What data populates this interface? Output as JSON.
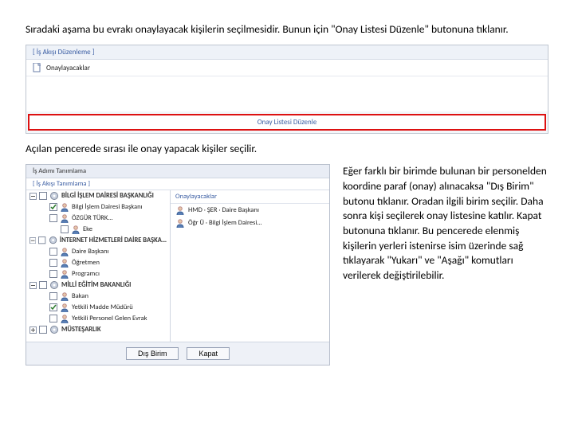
{
  "intro": "Sıradaki aşama bu evrakı onaylayacak kişilerin seçilmesidir. Bunun için \"Onay Listesi Düzenle\" butonuna tıklanır.",
  "win1": {
    "title": "[ İş Akışı Düzenleme ]",
    "node": "Onaylayacaklar",
    "highlight": "Onay Listesi Düzenle"
  },
  "mid": "Açılan pencerede sırası ile onay yapacak kişiler seçilir.",
  "win2": {
    "title": "İş Adımı Tanımlama",
    "subtitle": "[ İş Akışı Tanımlama ]",
    "right_head": "Onaylayacaklar",
    "tree": [
      {
        "lvl": 1,
        "toggle": "-",
        "chk": false,
        "label": "BİLGİ İŞLEM DAİRESİ BAŞKANLIĞI",
        "bold": true
      },
      {
        "lvl": 2,
        "toggle": "",
        "chk": true,
        "label": "Bilgi İşlem Dairesi Başkanı"
      },
      {
        "lvl": 2,
        "toggle": "",
        "chk": false,
        "label": "ÖZGÜR TÜRK…"
      },
      {
        "lvl": 3,
        "toggle": "",
        "chk": false,
        "label": "Eke"
      },
      {
        "lvl": 1,
        "toggle": "-",
        "chk": false,
        "label": "İNTERNET HİZMETLERİ DAİRE BAŞKA…",
        "bold": true
      },
      {
        "lvl": 2,
        "toggle": "",
        "chk": false,
        "label": "Daire Başkanı"
      },
      {
        "lvl": 2,
        "toggle": "",
        "chk": false,
        "label": "Öğretmen"
      },
      {
        "lvl": 2,
        "toggle": "",
        "chk": false,
        "label": "Programcı"
      },
      {
        "lvl": 1,
        "toggle": "-",
        "chk": false,
        "label": "MİLLİ EĞİTİM BAKANLIĞI",
        "bold": true
      },
      {
        "lvl": 2,
        "toggle": "",
        "chk": false,
        "label": "Bakan"
      },
      {
        "lvl": 2,
        "toggle": "",
        "chk": true,
        "label": "Yetkili Madde Müdürü"
      },
      {
        "lvl": 2,
        "toggle": "",
        "chk": false,
        "label": "Yetkili Personel Gelen Evrak"
      },
      {
        "lvl": 1,
        "toggle": "+",
        "chk": false,
        "label": "MÜSTEŞARLIK",
        "bold": true
      }
    ],
    "rlist": [
      {
        "label": "HMD · ŞER · Daire Başkanı"
      },
      {
        "label": "Öğr Ü · Bilgi İşlem Dairesi…"
      }
    ],
    "btn_dis": "Dış Birim",
    "btn_kapat": "Kapat"
  },
  "rtext": "Eğer farklı bir birimde bulunan bir personelden koordine paraf (onay) alınacaksa \"Dış Birim\" butonu tıklanır. Oradan ilgili birim seçilir. Daha sonra kişi seçilerek onay listesine katılır. Kapat butonuna tıklanır. Bu pencerede elenmiş kişilerin yerleri istenirse isim üzerinde sağ tıklayarak \"Yukarı\" ve \"Aşağı\" komutları verilerek değiştirilebilir."
}
